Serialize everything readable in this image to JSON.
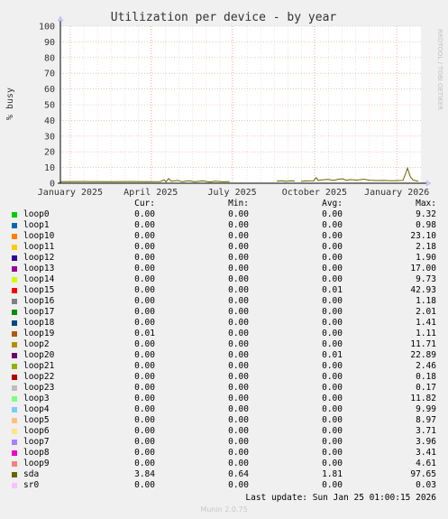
{
  "chart_data": {
    "type": "line",
    "title": "Utilization per device - by year",
    "ylabel": "% busy",
    "watermark": "RRDTOOL / TOBI OETIKER",
    "ylim": [
      0,
      100
    ],
    "yticks": [
      0,
      10,
      20,
      30,
      40,
      50,
      60,
      70,
      80,
      90,
      100
    ],
    "xlim": [
      "2024-12-21",
      "2026-01-28"
    ],
    "xticks": [
      {
        "date": "2025-01-01",
        "label": "January 2025"
      },
      {
        "date": "2025-04-01",
        "label": "April 2025"
      },
      {
        "date": "2025-07-01",
        "label": "July 2025"
      },
      {
        "date": "2025-10-01",
        "label": "October 2025"
      },
      {
        "date": "2026-01-01",
        "label": "January 2026"
      }
    ],
    "colors": {
      "background": "#f0f0f0",
      "plot_bg": "#ffffff",
      "major_grid": "#e8a0a0",
      "minor_grid": "#f0c8c8",
      "axis": "#000000",
      "line": "#4a4a00"
    },
    "series": [
      {
        "name": "sda",
        "color": "#666600",
        "segments": [
          [
            [
              "2024-12-21",
              1.0
            ],
            [
              "2025-01-15",
              1.1
            ],
            [
              "2025-02-10",
              1.0
            ],
            [
              "2025-03-05",
              1.1
            ],
            [
              "2025-03-25",
              1.0
            ],
            [
              "2025-04-12",
              1.1
            ],
            [
              "2025-04-16",
              2.2
            ],
            [
              "2025-04-18",
              0.8
            ],
            [
              "2025-04-21",
              3.0
            ],
            [
              "2025-04-24",
              1.2
            ],
            [
              "2025-05-01",
              1.8
            ],
            [
              "2025-05-06",
              1.0
            ],
            [
              "2025-05-14",
              1.6
            ],
            [
              "2025-05-20",
              0.9
            ],
            [
              "2025-05-29",
              1.5
            ],
            [
              "2025-06-06",
              0.8
            ],
            [
              "2025-06-12",
              1.3
            ],
            [
              "2025-06-20",
              0.9
            ],
            [
              "2025-06-28",
              1.0
            ]
          ],
          [
            [
              "2025-08-20",
              1.3
            ],
            [
              "2025-08-25",
              1.6
            ],
            [
              "2025-08-30",
              1.2
            ],
            [
              "2025-09-04",
              1.5
            ],
            [
              "2025-09-09",
              1.4
            ]
          ],
          [
            [
              "2025-09-16",
              1.2
            ],
            [
              "2025-09-23",
              1.5
            ],
            [
              "2025-09-30",
              1.6
            ],
            [
              "2025-10-03",
              3.6
            ],
            [
              "2025-10-05",
              1.8
            ],
            [
              "2025-10-09",
              2.1
            ],
            [
              "2025-10-16",
              2.4
            ],
            [
              "2025-10-22",
              1.8
            ],
            [
              "2025-10-28",
              2.6
            ],
            [
              "2025-11-02",
              2.8
            ],
            [
              "2025-11-05",
              1.9
            ],
            [
              "2025-11-10",
              2.3
            ],
            [
              "2025-11-18",
              2.0
            ],
            [
              "2025-11-25",
              2.6
            ],
            [
              "2025-12-02",
              1.9
            ],
            [
              "2025-12-10",
              1.7
            ],
            [
              "2025-12-18",
              1.8
            ],
            [
              "2025-12-26",
              1.6
            ],
            [
              "2026-01-02",
              1.7
            ],
            [
              "2026-01-08",
              1.8
            ],
            [
              "2026-01-13",
              9.6
            ],
            [
              "2026-01-16",
              4.2
            ],
            [
              "2026-01-19",
              2.1
            ],
            [
              "2026-01-22",
              1.6
            ],
            [
              "2026-01-25",
              1.3
            ]
          ]
        ]
      }
    ]
  },
  "legend": {
    "headers": {
      "cur": "Cur:",
      "min": "Min:",
      "avg": "Avg:",
      "max": "Max:"
    },
    "rows": [
      {
        "name": "loop0",
        "color": "#00cc00",
        "cur": "0.00",
        "min": "0.00",
        "avg": "0.00",
        "max": "9.32"
      },
      {
        "name": "loop1",
        "color": "#0066b3",
        "cur": "0.00",
        "min": "0.00",
        "avg": "0.00",
        "max": "0.98"
      },
      {
        "name": "loop10",
        "color": "#ff8000",
        "cur": "0.00",
        "min": "0.00",
        "avg": "0.00",
        "max": "23.10"
      },
      {
        "name": "loop11",
        "color": "#ffcc00",
        "cur": "0.00",
        "min": "0.00",
        "avg": "0.00",
        "max": "2.18"
      },
      {
        "name": "loop12",
        "color": "#330099",
        "cur": "0.00",
        "min": "0.00",
        "avg": "0.00",
        "max": "1.90"
      },
      {
        "name": "loop13",
        "color": "#990099",
        "cur": "0.00",
        "min": "0.00",
        "avg": "0.00",
        "max": "17.00"
      },
      {
        "name": "loop14",
        "color": "#ccff00",
        "cur": "0.00",
        "min": "0.00",
        "avg": "0.00",
        "max": "9.73"
      },
      {
        "name": "loop15",
        "color": "#ff0000",
        "cur": "0.00",
        "min": "0.00",
        "avg": "0.01",
        "max": "42.93"
      },
      {
        "name": "loop16",
        "color": "#808080",
        "cur": "0.00",
        "min": "0.00",
        "avg": "0.00",
        "max": "1.18"
      },
      {
        "name": "loop17",
        "color": "#008f00",
        "cur": "0.00",
        "min": "0.00",
        "avg": "0.00",
        "max": "2.01"
      },
      {
        "name": "loop18",
        "color": "#00487d",
        "cur": "0.00",
        "min": "0.00",
        "avg": "0.00",
        "max": "1.41"
      },
      {
        "name": "loop19",
        "color": "#b35a00",
        "cur": "0.01",
        "min": "0.00",
        "avg": "0.00",
        "max": "1.11"
      },
      {
        "name": "loop2",
        "color": "#b38f00",
        "cur": "0.00",
        "min": "0.00",
        "avg": "0.00",
        "max": "11.71"
      },
      {
        "name": "loop20",
        "color": "#6b006b",
        "cur": "0.00",
        "min": "0.00",
        "avg": "0.01",
        "max": "22.89"
      },
      {
        "name": "loop21",
        "color": "#8fb300",
        "cur": "0.00",
        "min": "0.00",
        "avg": "0.00",
        "max": "2.46"
      },
      {
        "name": "loop22",
        "color": "#b30000",
        "cur": "0.00",
        "min": "0.00",
        "avg": "0.00",
        "max": "0.18"
      },
      {
        "name": "loop23",
        "color": "#bebebe",
        "cur": "0.00",
        "min": "0.00",
        "avg": "0.00",
        "max": "0.17"
      },
      {
        "name": "loop3",
        "color": "#80ff80",
        "cur": "0.00",
        "min": "0.00",
        "avg": "0.00",
        "max": "11.82"
      },
      {
        "name": "loop4",
        "color": "#80c9ff",
        "cur": "0.00",
        "min": "0.00",
        "avg": "0.00",
        "max": "9.99"
      },
      {
        "name": "loop5",
        "color": "#ffc080",
        "cur": "0.00",
        "min": "0.00",
        "avg": "0.00",
        "max": "8.97"
      },
      {
        "name": "loop6",
        "color": "#ffe680",
        "cur": "0.00",
        "min": "0.00",
        "avg": "0.00",
        "max": "3.71"
      },
      {
        "name": "loop7",
        "color": "#aa80ff",
        "cur": "0.00",
        "min": "0.00",
        "avg": "0.00",
        "max": "3.96"
      },
      {
        "name": "loop8",
        "color": "#ee00cc",
        "cur": "0.00",
        "min": "0.00",
        "avg": "0.00",
        "max": "3.41"
      },
      {
        "name": "loop9",
        "color": "#ff8080",
        "cur": "0.00",
        "min": "0.00",
        "avg": "0.00",
        "max": "4.61"
      },
      {
        "name": "sda",
        "color": "#666600",
        "cur": "3.84",
        "min": "0.64",
        "avg": "1.81",
        "max": "97.65"
      },
      {
        "name": "sr0",
        "color": "#ffbfff",
        "cur": "0.00",
        "min": "0.00",
        "avg": "0.00",
        "max": "0.03"
      }
    ]
  },
  "footer": {
    "last_update": "Last update: Sun Jan 25 01:00:15 2026",
    "munin": "Munin 2.0.75"
  }
}
